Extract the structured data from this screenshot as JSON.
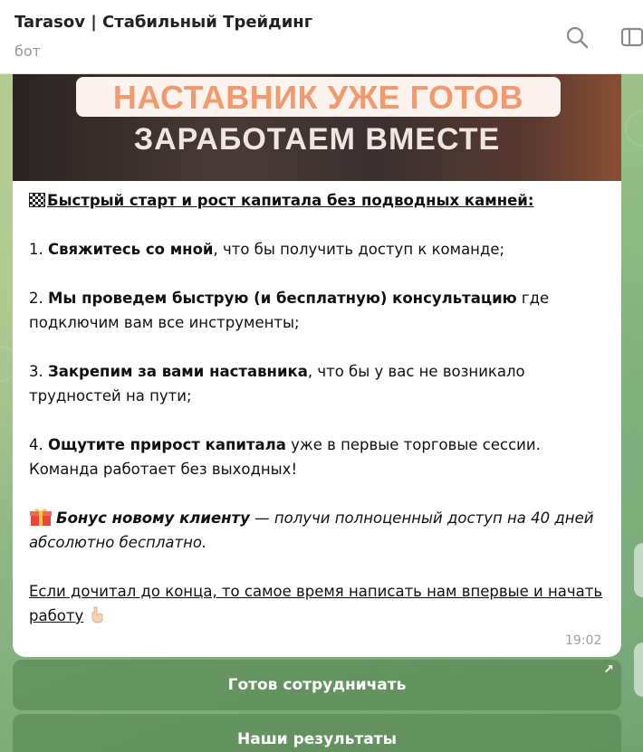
{
  "header": {
    "title": "Tarasov | Стабильный Трейдинг",
    "subtitle": "бот",
    "icons": [
      "search-icon",
      "side-panel-icon"
    ]
  },
  "message": {
    "banner_line1": "НАСТАВНИК УЖЕ ГОТОВ",
    "banner_line2": "ЗАРАБОТАЕМ ВМЕСТЕ",
    "heading": "Быстрый старт и рост капитала без подводных камней:",
    "step1_num": "1. ",
    "step1_bold": "Свяжитесь со мной",
    "step1_rest": ", что бы получить доступ к команде;",
    "step2_num": "2. ",
    "step2_bold": "Мы проведем быструю (и бесплатную) консультацию",
    "step2_rest": " где подключим вам все инструменты;",
    "step3_num": "3. ",
    "step3_bold": "Закрепим за вами наставника",
    "step3_rest": ", что бы у вас не возникало трудностей на пути;",
    "step4_num": "4. ",
    "step4_bold": "Ощутите прирост капитала",
    "step4_rest": " уже в первые торговые сессии. Команда работает без выходных!",
    "bonus_bold": "Бонус новому клиенту",
    "bonus_rest": " — получи полноценный доступ на 40 дней абсолютно бесплатно.",
    "cta": "Если дочитал до конца, то самое время написать нам впервые и начать работу",
    "time": "19:02"
  },
  "keyboard": {
    "buttons": [
      {
        "label": "Готов сотрудничать",
        "arrow": "↗"
      },
      {
        "label": "Наши результаты"
      }
    ]
  },
  "colors": {
    "accent_banner": "#f29a6e",
    "button_bg": "#5c8b58",
    "background_green": "#90bb85"
  }
}
